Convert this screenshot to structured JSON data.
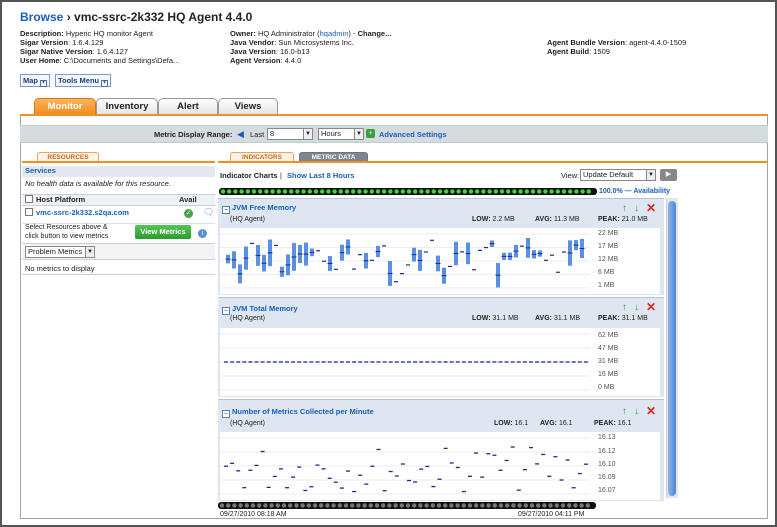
{
  "header": {
    "browse": "Browse",
    "title": " › vmc-ssrc-2k332 HQ Agent 4.4.0"
  },
  "props": {
    "description": {
      "label": "Description:",
      "value": "Hyperic HQ monitor Agent"
    },
    "sigar_version": {
      "label": "Sigar Version",
      "value": ": 1.6.4.129"
    },
    "sigar_native": {
      "label": "Sigar Native Version",
      "value": ": 1.6.4.127"
    },
    "user_home": {
      "label": "User Home",
      "value": ": C:\\Documents and Settings\\Defa..."
    },
    "owner": {
      "label": "Owner:",
      "value": "HQ Administrator (",
      "link": "hqadmin",
      "value2": ") - ",
      "change": "Change..."
    },
    "java_vendor": {
      "label": "Java Vendor",
      "value": ": Sun Microsystems Inc."
    },
    "java_version": {
      "label": "Java Version",
      "value": ": 16.0-b13"
    },
    "agent_version": {
      "label": "Agent Version",
      "value": ": 4.4.0"
    },
    "bundle": {
      "label": "Agent Bundle Version",
      "value": ": agent-4.4.0-1509"
    },
    "build": {
      "label": "Agent Build",
      "value": ": 1509"
    }
  },
  "buttons": {
    "map": "Map",
    "tools": "Tools Menu"
  },
  "tabs": [
    "Monitor",
    "Inventory",
    "Alert",
    "Views"
  ],
  "range": {
    "label": "Metric Display Range:",
    "last": "Last",
    "value": "8",
    "unit": "Hours",
    "advanced": "Advanced Settings"
  },
  "subtabs": {
    "resources": "RESOURCES",
    "indicators": "INDICATORS",
    "metric_data": "METRIC DATA"
  },
  "left": {
    "services": "Services",
    "no_health": "No health data is available for this resource.",
    "host_platform": "Host Platform",
    "avail": "Avail",
    "host": "vmc-ssrc-2k332.s2qa.com",
    "select_text1": "Select Resources above &",
    "select_text2": "click button to view metrics",
    "view_metrics": "View Metrics",
    "problem_metrics": "Problem Metrics",
    "no_metrics": "No metrics to display"
  },
  "indicators": {
    "title": "Indicator Charts",
    "sep": "|",
    "show_last": "Show Last 8 Hours",
    "view_label": "View:",
    "view_value": "Update Default",
    "availability": "100.0% — Availability"
  },
  "charts": [
    {
      "name": "JVM Free Memory",
      "sub": "(HQ Agent)",
      "low": "2.2 MB",
      "avg": "11.3 MB",
      "peak": "21.0 MB",
      "ticks": [
        "22 MB",
        "17 MB",
        "12 MB",
        "6 MB",
        "1 MB"
      ]
    },
    {
      "name": "JVM Total Memory",
      "sub": "(HQ Agent)",
      "low": "31.1 MB",
      "avg": "31.1 MB",
      "peak": "31.1 MB",
      "ticks": [
        "62 MB",
        "47 MB",
        "31 MB",
        "16 MB",
        "0 MB"
      ]
    },
    {
      "name": "Number of Metrics Collected per Minute",
      "sub": "(HQ Agent)",
      "low": "16.1",
      "avg": "16.1",
      "peak": "16.1",
      "ticks": [
        "16.13",
        "16.12",
        "16.10",
        "16.09",
        "16.07"
      ]
    }
  ],
  "stat_labels": {
    "low": "LOW:",
    "avg": "AVG:",
    "peak": "PEAK:"
  },
  "time": {
    "start": "09/27/2010 08:18 AM",
    "end": "09/27/2010 04:11 PM"
  }
}
